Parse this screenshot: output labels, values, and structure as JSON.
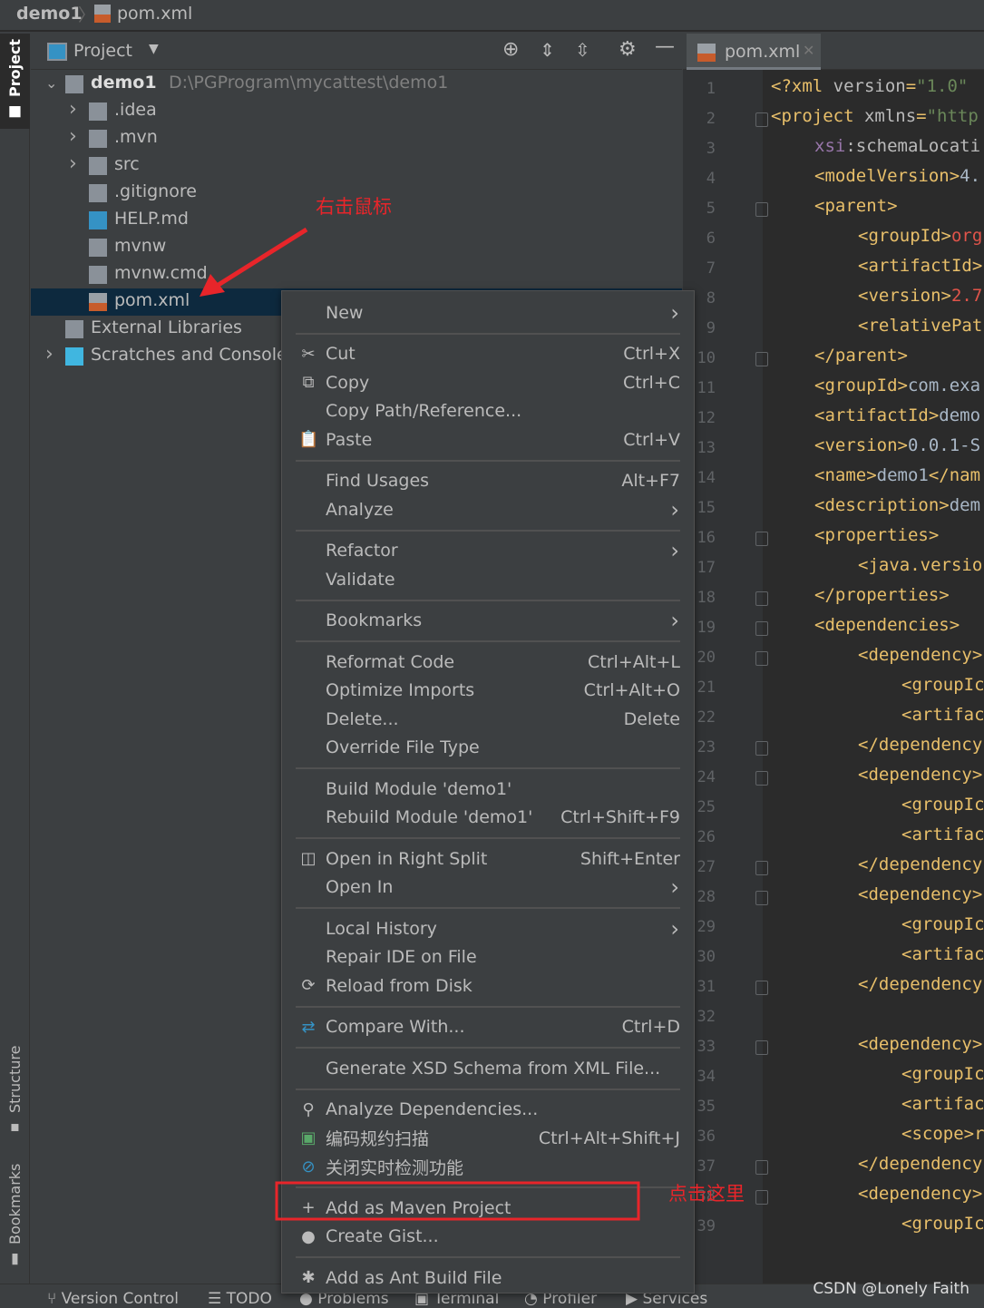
{
  "breadcrumb": {
    "project": "demo1",
    "file": "pom.xml"
  },
  "left_strip": {
    "project": "Project",
    "structure": "Structure",
    "bookmarks": "Bookmarks"
  },
  "panel": {
    "title": "Project"
  },
  "tree": [
    {
      "label": "demo1",
      "path": "D:\\PGProgram\\mycattest\\demo1",
      "icon": "module-folder-icon",
      "chevron": "down",
      "level": 0
    },
    {
      "label": ".idea",
      "icon": "folder-icon",
      "chevron": "right",
      "level": 1
    },
    {
      "label": ".mvn",
      "icon": "folder-icon",
      "chevron": "right",
      "level": 1
    },
    {
      "label": "src",
      "icon": "folder-icon",
      "chevron": "right",
      "level": 1
    },
    {
      "label": ".gitignore",
      "icon": "gitignore-file-icon",
      "level": 1
    },
    {
      "label": "HELP.md",
      "icon": "markdown-file-icon",
      "level": 1
    },
    {
      "label": "mvnw",
      "icon": "shell-script-icon",
      "level": 1
    },
    {
      "label": "mvnw.cmd",
      "icon": "text-file-icon",
      "level": 1
    },
    {
      "label": "pom.xml",
      "icon": "xml-file-icon",
      "level": 1,
      "selected": true
    },
    {
      "label": "External Libraries",
      "icon": "libraries-icon",
      "level": 0
    },
    {
      "label": "Scratches and Consoles",
      "icon": "scratches-icon",
      "chevron": "right",
      "level": 0
    }
  ],
  "editor": {
    "tab": "pom.xml",
    "lines": [
      [
        0,
        "<?xml version=\"1.0\""
      ],
      [
        0,
        "<project xmlns=\"http"
      ],
      [
        1,
        "xsi:schemaLocati"
      ],
      [
        1,
        "<modelVersion>4."
      ],
      [
        1,
        "<parent>"
      ],
      [
        2,
        "<groupId>org"
      ],
      [
        2,
        "<artifactId>"
      ],
      [
        2,
        "<version>2.7"
      ],
      [
        2,
        "<relativePat"
      ],
      [
        1,
        "</parent>"
      ],
      [
        1,
        "<groupId>com.exa"
      ],
      [
        1,
        "<artifactId>demo"
      ],
      [
        1,
        "<version>0.0.1-S"
      ],
      [
        1,
        "<name>demo1</nam"
      ],
      [
        1,
        "<description>dem"
      ],
      [
        1,
        "<properties>"
      ],
      [
        2,
        "<java.versio"
      ],
      [
        1,
        "</properties>"
      ],
      [
        1,
        "<dependencies>"
      ],
      [
        2,
        "<dependency>"
      ],
      [
        3,
        "<groupIc"
      ],
      [
        3,
        "<artifac"
      ],
      [
        2,
        "</dependency"
      ],
      [
        2,
        "<dependency>"
      ],
      [
        3,
        "<groupIc"
      ],
      [
        3,
        "<artifac"
      ],
      [
        2,
        "</dependency"
      ],
      [
        2,
        "<dependency>"
      ],
      [
        3,
        "<groupIc"
      ],
      [
        3,
        "<artifac"
      ],
      [
        2,
        "</dependency"
      ],
      [
        0,
        ""
      ],
      [
        2,
        "<dependency>"
      ],
      [
        3,
        "<groupIc"
      ],
      [
        3,
        "<artifac"
      ],
      [
        3,
        "<scope>r"
      ],
      [
        2,
        "</dependency"
      ],
      [
        2,
        "<dependency>"
      ],
      [
        3,
        "<groupIc"
      ]
    ]
  },
  "context_menu": [
    {
      "label": "New",
      "submenu": true
    },
    {
      "sep": true
    },
    {
      "label": "Cut",
      "shortcut": "Ctrl+X",
      "icon": "scissors-icon",
      "glyph": "✂"
    },
    {
      "label": "Copy",
      "shortcut": "Ctrl+C",
      "icon": "copy-icon",
      "glyph": "⧉"
    },
    {
      "label": "Copy Path/Reference..."
    },
    {
      "label": "Paste",
      "shortcut": "Ctrl+V",
      "icon": "clipboard-icon",
      "glyph": "📋"
    },
    {
      "sep": true
    },
    {
      "label": "Find Usages",
      "shortcut": "Alt+F7"
    },
    {
      "label": "Analyze",
      "submenu": true
    },
    {
      "sep": true
    },
    {
      "label": "Refactor",
      "submenu": true
    },
    {
      "label": "Validate"
    },
    {
      "sep": true
    },
    {
      "label": "Bookmarks",
      "submenu": true
    },
    {
      "sep": true
    },
    {
      "label": "Reformat Code",
      "shortcut": "Ctrl+Alt+L"
    },
    {
      "label": "Optimize Imports",
      "shortcut": "Ctrl+Alt+O"
    },
    {
      "label": "Delete...",
      "shortcut": "Delete"
    },
    {
      "label": "Override File Type"
    },
    {
      "sep": true
    },
    {
      "label": "Build Module 'demo1'"
    },
    {
      "label": "Rebuild Module 'demo1'",
      "shortcut": "Ctrl+Shift+F9"
    },
    {
      "sep": true
    },
    {
      "label": "Open in Right Split",
      "shortcut": "Shift+Enter",
      "icon": "split-icon",
      "glyph": "◫"
    },
    {
      "label": "Open In",
      "submenu": true
    },
    {
      "sep": true
    },
    {
      "label": "Local History",
      "submenu": true
    },
    {
      "label": "Repair IDE on File"
    },
    {
      "label": "Reload from Disk",
      "icon": "reload-icon",
      "glyph": "⟳"
    },
    {
      "sep": true
    },
    {
      "label": "Compare With...",
      "shortcut": "Ctrl+D",
      "icon": "compare-icon",
      "glyph": "⇄"
    },
    {
      "sep": true
    },
    {
      "label": "Generate XSD Schema from XML File..."
    },
    {
      "sep": true
    },
    {
      "label": "Analyze Dependencies...",
      "icon": "analyze-dependencies-icon",
      "glyph": "⚲"
    },
    {
      "label": "编码规约扫描",
      "shortcut": "Ctrl+Alt+Shift+J",
      "icon": "code-scan-icon",
      "glyph": "▣"
    },
    {
      "label": "关闭实时检测功能",
      "icon": "disable-icon",
      "glyph": "⊘"
    },
    {
      "sep": true
    },
    {
      "label": "Add as Maven Project",
      "icon": "plus-icon",
      "glyph": "+"
    },
    {
      "label": "Create Gist...",
      "icon": "github-icon",
      "glyph": "●"
    },
    {
      "sep": true
    },
    {
      "label": "Add as Ant Build File",
      "icon": "ant-icon",
      "glyph": "✱"
    }
  ],
  "annotations": {
    "right_click": "右击鼠标",
    "click_here": "点击这里",
    "color": "#e8252a"
  },
  "statusbar": {
    "version_control": "Version Control",
    "todo": "TODO",
    "problems": "Problems",
    "terminal": "Terminal",
    "profiler": "Profiler",
    "services": "Services"
  },
  "watermark": "CSDN @Lonely Faith"
}
